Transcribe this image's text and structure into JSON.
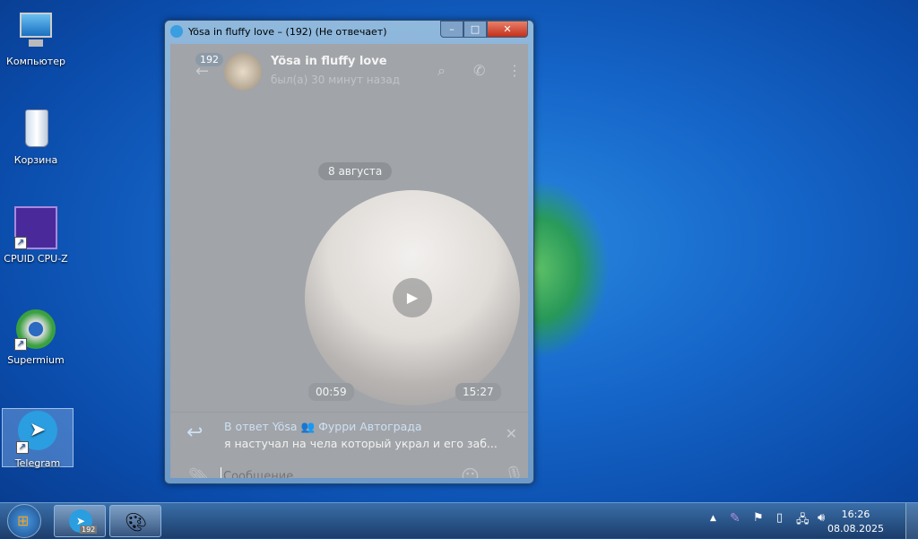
{
  "desktop": {
    "icons": [
      {
        "label": "Компьютер"
      },
      {
        "label": "Корзина"
      },
      {
        "label": "CPUID CPU-Z"
      },
      {
        "label": "Supermium"
      },
      {
        "label": "Telegram"
      }
    ]
  },
  "window": {
    "title": "Yösa in fluffy love – (192) (Не отвечает)",
    "minimize": "–",
    "maximize": "□",
    "close": "✕"
  },
  "chat": {
    "unread_badge": "192",
    "name": "Yösa in fluffy love",
    "status": "был(а) 30 минут назад",
    "date_separator": "8 августа",
    "video_duration": "00:59",
    "video_time": "15:27",
    "reply": {
      "header": "В ответ Yösa 👥 Фурри Автограда",
      "text": "я настучал на чела который украл и его заб..."
    },
    "input_placeholder": "Сообщение..."
  },
  "taskbar": {
    "telegram_badge": "192",
    "time": "16:26",
    "date": "08.08.2025"
  },
  "colors": {
    "accent": "#3a9ee0",
    "reply_header": "#cde0f4"
  }
}
